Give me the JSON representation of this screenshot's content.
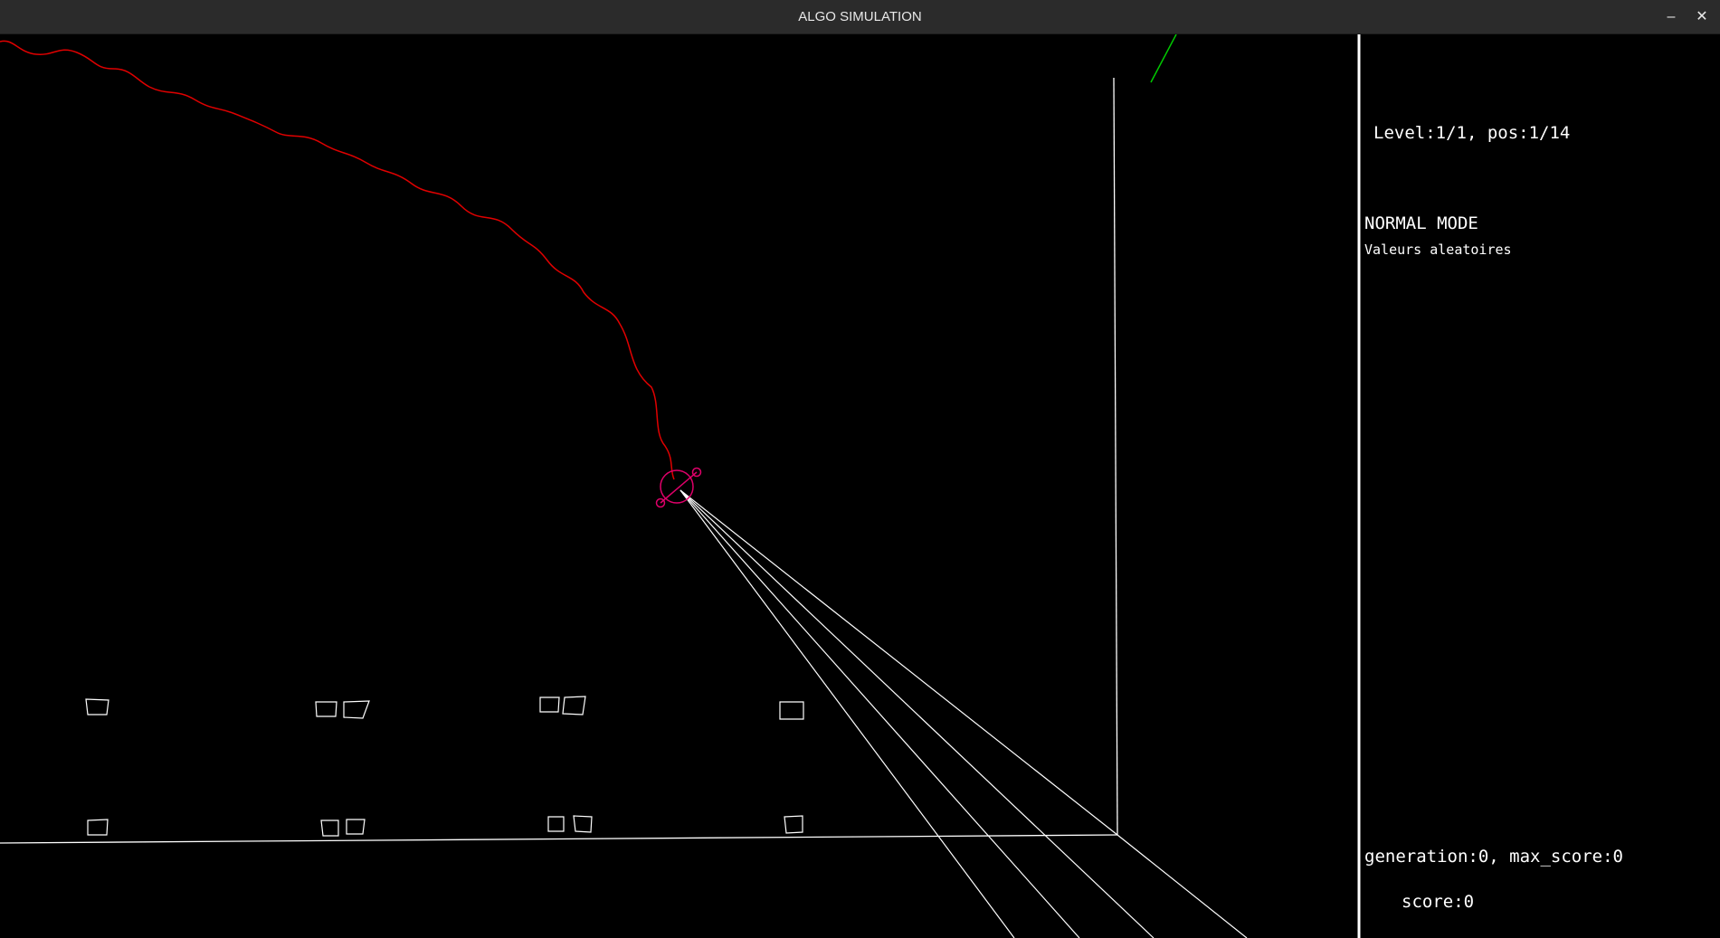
{
  "window": {
    "title": "ALGO SIMULATION",
    "minimize_label": "–",
    "close_label": "✕"
  },
  "hud": {
    "level": "Level:1/1, pos:1/14",
    "mode": "NORMAL MODE",
    "submode": "Valeurs aleatoires",
    "generation": "generation:0, max_score:0",
    "score": "score:0"
  },
  "colors": {
    "background": "#000000",
    "titlebar": "#2b2b2b",
    "walls": "#ffffff",
    "trail": "#e00000",
    "agent": "#e0006a",
    "sensor": "#00c800"
  }
}
